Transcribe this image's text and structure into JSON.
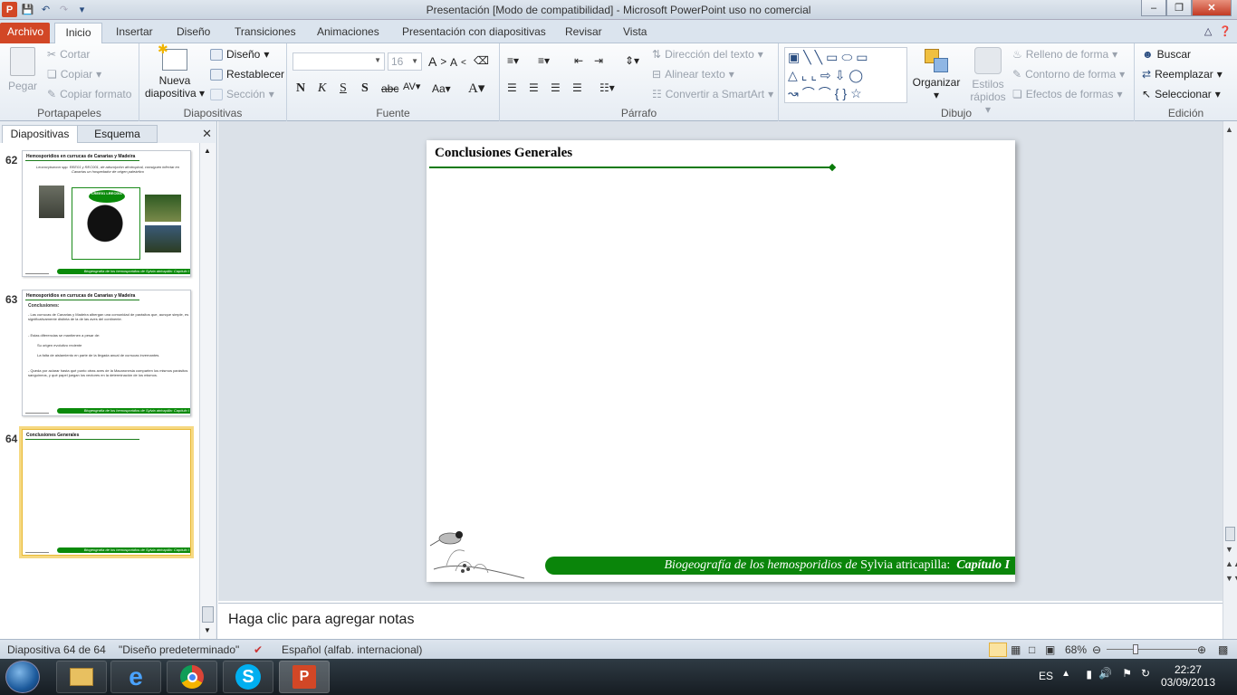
{
  "window": {
    "title": "Presentación [Modo de compatibilidad]  -  Microsoft PowerPoint uso no comercial"
  },
  "tabs": {
    "file": "Archivo",
    "items": [
      "Inicio",
      "Insertar",
      "Diseño",
      "Transiciones",
      "Animaciones",
      "Presentación con diapositivas",
      "Revisar",
      "Vista"
    ]
  },
  "ribbon": {
    "portapapeles": {
      "label": "Portapapeles",
      "pegar": "Pegar",
      "cortar": "Cortar",
      "copiar": "Copiar",
      "copiar_formato": "Copiar formato"
    },
    "diapositivas": {
      "label": "Diapositivas",
      "nueva1": "Nueva",
      "nueva2": "diapositiva",
      "diseno": "Diseño",
      "restablecer": "Restablecer",
      "seccion": "Sección"
    },
    "fuente": {
      "label": "Fuente",
      "size": "16"
    },
    "parrafo": {
      "label": "Párrafo",
      "direccion": "Dirección del texto",
      "alinear": "Alinear texto",
      "convertir": "Convertir a SmartArt"
    },
    "dibujo": {
      "label": "Dibujo",
      "organizar": "Organizar",
      "estilos1": "Estilos",
      "estilos2": "rápidos",
      "relleno": "Relleno de forma",
      "contorno": "Contorno de forma",
      "efectos": "Efectos de formas"
    },
    "edicion": {
      "label": "Edición",
      "buscar": "Buscar",
      "reemplazar": "Reemplazar",
      "seleccionar": "Seleccionar"
    }
  },
  "panel": {
    "tab_slides": "Diapositivas",
    "tab_outline": "Esquema"
  },
  "thumbs": [
    {
      "num": "62",
      "title": "Hemosporidios en currucas de Canarias y Madeira",
      "text": "Leucocytozoon spp. REE01 y REC001, de adscripción afrotropical, consiguen infectar en Canarias un hospedador de origen paleártico",
      "badge": "LREE01 LREC001"
    },
    {
      "num": "63",
      "title": "Hemosporidios en currucas de Canarias y Madeira",
      "heading": "Conclusiones:",
      "lines": [
        "- Las currucas de Canarias y Madeira albergan una comunidad de parásitos que, aunque simple, es significativamente distinta de la de las aves del continente.",
        "- Estas diferencias se mantienen a pesar de:",
        "Su origen evolutivo reciente",
        "La falta de aislamiento en parte de la llegada anual de currucas invernantes.",
        "- Queda por aclarar hasta qué punto otras aves de la Macaronesia comparten los mismos parásitos sanguíneos, y qué papel juegan los vectores en la determinación de los mismos."
      ]
    },
    {
      "num": "64",
      "title": "Conclusiones Generales"
    }
  ],
  "thumb_footer": "Biogeografía de los hemosporidios de Sylvia atricapilla: Capítulo I",
  "slide": {
    "title": "Conclusiones  Generales",
    "footer_a": "Biogeografía de los hemosporidios  de ",
    "footer_b": "Sylvia  atricapilla:",
    "footer_c": "Capítulo I"
  },
  "notes": {
    "placeholder": "Haga clic para agregar notas"
  },
  "status": {
    "slide": "Diapositiva 64 de 64",
    "theme": "\"Diseño predeterminado\"",
    "lang": "Español (alfab. internacional)",
    "zoom": "68%"
  },
  "tray": {
    "lang": "ES",
    "time": "22:27",
    "date": "03/09/2013"
  },
  "colors": {
    "accent": "#0a850a",
    "file_tab": "#d24726"
  }
}
